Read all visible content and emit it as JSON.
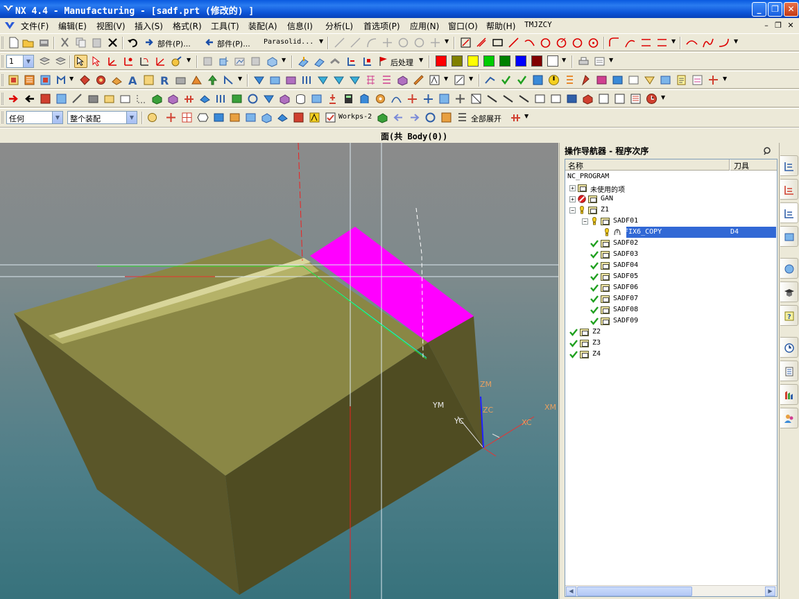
{
  "window": {
    "title": "NX 4.4 - Manufacturing - [sadf.prt  (修改的) ]"
  },
  "menubar": {
    "items": [
      "文件(F)",
      "编辑(E)",
      "视图(V)",
      "插入(S)",
      "格式(R)",
      "工具(T)",
      "装配(A)",
      "信息(I)",
      "分析(L)",
      "首选项(P)",
      "应用(N)",
      "窗口(O)",
      "帮助(H)",
      "TMJZCY"
    ]
  },
  "toolbar1": {
    "part_label_1": "部件(P)...",
    "part_label_2": "部件(P)...",
    "parasolid_label": "Parasolid..."
  },
  "toolbar2": {
    "layer_value": "1",
    "postprocess_label": "后处理",
    "colors": [
      "#ff0000",
      "#808000",
      "#ffff00",
      "#00cc00",
      "#008000",
      "#0000ff",
      "#800000",
      "#ffffff"
    ]
  },
  "toolbar5": {
    "filter_value": "任何",
    "scope_value": "整个装配",
    "workps_label": "Workps-2",
    "expand_all_label": "全部展开"
  },
  "status": {
    "selection_text": "面(共 Body(0))"
  },
  "viewport": {
    "wcs_labels": {
      "zm": "ZM",
      "zc": "ZC",
      "xm": "XM",
      "xc": "XC",
      "ym": "YM",
      "yc": "YC"
    }
  },
  "navigator": {
    "title": "操作导航器 - 程序次序",
    "col_name": "名称",
    "col_tool": "刀具",
    "rows": [
      {
        "label": "NC_PROGRAM",
        "tool": "",
        "status": "none"
      },
      {
        "label": "未使用的项",
        "tool": "",
        "status": "group"
      },
      {
        "label": "GAN",
        "tool": "",
        "status": "error"
      },
      {
        "label": "Z1",
        "tool": "",
        "status": "warn"
      },
      {
        "label": "SADF01",
        "tool": "",
        "status": "warn"
      },
      {
        "label": "FIX6_COPY",
        "tool": "D4",
        "status": "warn-op"
      },
      {
        "label": "SADF02",
        "tool": "",
        "status": "ok"
      },
      {
        "label": "SADF03",
        "tool": "",
        "status": "ok"
      },
      {
        "label": "SADF04",
        "tool": "",
        "status": "ok"
      },
      {
        "label": "SADF05",
        "tool": "",
        "status": "ok"
      },
      {
        "label": "SADF06",
        "tool": "",
        "status": "ok"
      },
      {
        "label": "SADF07",
        "tool": "",
        "status": "ok"
      },
      {
        "label": "SADF08",
        "tool": "",
        "status": "ok"
      },
      {
        "label": "SADF09",
        "tool": "",
        "status": "ok"
      },
      {
        "label": "Z2",
        "tool": "",
        "status": "ok"
      },
      {
        "label": "Z3",
        "tool": "",
        "status": "ok"
      },
      {
        "label": "Z4",
        "tool": "",
        "status": "ok"
      }
    ]
  },
  "colors": {
    "title_blue": "#0a5ae0",
    "highlight_face": "#ff00ff",
    "part_olive": "#8a8745",
    "selection": "#3168d5",
    "ok_green": "#1fa01f"
  }
}
